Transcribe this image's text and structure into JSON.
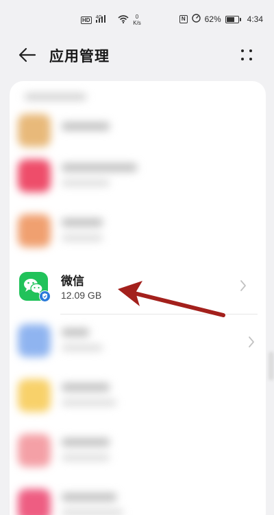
{
  "status_bar": {
    "hd": "HD",
    "network": "4G",
    "speed_value": "0",
    "speed_unit": "K/s",
    "nfc": "N",
    "battery": "62%",
    "time": "4:34"
  },
  "header": {
    "title": "应用管理",
    "back_icon": "back-arrow-icon",
    "more_icon": "more-dots-icon"
  },
  "highlighted_app": {
    "name": "微信",
    "size": "12.09 GB",
    "icon": "wechat-icon",
    "badge_icon": "verified-shield-icon"
  },
  "colors": {
    "wechat_green": "#21c25a",
    "annotation_red": "#a3201c",
    "badge_blue": "#2a7ad9"
  },
  "blurred_icon_colors": [
    "#e8b97a",
    "#ee4d6a",
    "#f0a070",
    "#8fb4f0",
    "#f8d16a",
    "#f4a0a6",
    "#ee5d82"
  ]
}
